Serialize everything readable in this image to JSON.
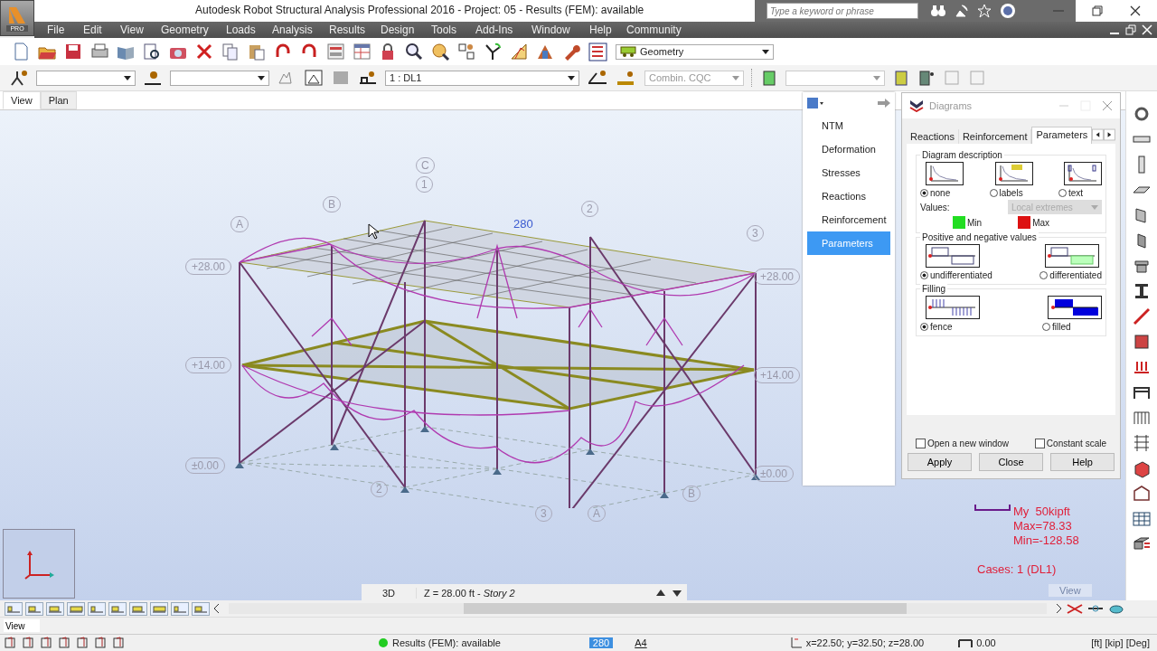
{
  "window": {
    "title": "Autodesk Robot Structural Analysis Professional 2016 - Project: 05 - Results (FEM): available",
    "logo_badge": "PRO"
  },
  "search": {
    "placeholder": "Type a keyword or phrase"
  },
  "menu": [
    "File",
    "Edit",
    "View",
    "Geometry",
    "Loads",
    "Analysis",
    "Results",
    "Design",
    "Tools",
    "Add-Ins",
    "Window",
    "Help",
    "Community"
  ],
  "toolbar": {
    "layout_select": "Geometry",
    "load_case_select": "1 : DL1",
    "combination_select": {
      "value": "Combin. CQC",
      "disabled": true
    }
  },
  "view_tabs": [
    {
      "label": "View",
      "selected": true
    },
    {
      "label": "Plan",
      "selected": false
    }
  ],
  "model": {
    "grid_labels": [
      "C",
      "1",
      "B",
      "A",
      "2",
      "3",
      "2",
      "B",
      "3",
      "A"
    ],
    "level_labels": [
      "+28.00",
      "+14.00",
      "±0.00",
      "+28.00",
      "+14.00",
      "±0.00"
    ],
    "value_label": "280"
  },
  "diagram_menu": [
    {
      "label": "NTM",
      "selected": false
    },
    {
      "label": "Deformation",
      "selected": false
    },
    {
      "label": "Stresses",
      "selected": false
    },
    {
      "label": "Reactions",
      "selected": false
    },
    {
      "label": "Reinforcement",
      "selected": false
    },
    {
      "label": "Parameters",
      "selected": true
    }
  ],
  "dialog": {
    "title": "Diagrams",
    "tabs": [
      {
        "label": "Reactions",
        "selected": false
      },
      {
        "label": "Reinforcement",
        "selected": false
      },
      {
        "label": "Parameters",
        "selected": true
      }
    ],
    "groups": [
      {
        "title": "Diagram description",
        "options": [
          {
            "label": "none",
            "selected": true
          },
          {
            "label": "labels",
            "selected": false
          },
          {
            "label": "text",
            "selected": false
          }
        ],
        "values": {
          "label": "Values:",
          "select": "Local extremes",
          "disabled": true,
          "legend": [
            {
              "label": "Min",
              "color": "#22dd22"
            },
            {
              "label": "Max",
              "color": "#dd1111"
            }
          ]
        }
      },
      {
        "title": "Positive and negative values",
        "options": [
          {
            "label": "undifferentiated",
            "selected": true
          },
          {
            "label": "differentiated",
            "selected": false
          }
        ]
      },
      {
        "title": "Filling",
        "options": [
          {
            "label": "fence",
            "selected": true
          },
          {
            "label": "filled",
            "selected": false
          }
        ]
      }
    ],
    "checkboxes": [
      {
        "label": "Open a new window",
        "checked": false
      },
      {
        "label": "Constant scale",
        "checked": false
      }
    ],
    "buttons": [
      "Apply",
      "Close",
      "Help"
    ]
  },
  "legend": {
    "lines": [
      "My  50kipft",
      "Max=78.33",
      "Min=-128.58"
    ],
    "cases": "Cases: 1 (DL1)"
  },
  "view_bar": {
    "mode": "3D",
    "story": "Z = 28.00 ft - *Story 2*"
  },
  "canvas_caption": "View",
  "command": {
    "value": "View"
  },
  "status_bar": {
    "results": "Results (FEM): available",
    "selection": "280",
    "paper": "A4",
    "coordinates": "x=22.50; y=32.50; z=28.00",
    "angle": "0.00",
    "units": "[ft] [kip] [Deg]"
  }
}
